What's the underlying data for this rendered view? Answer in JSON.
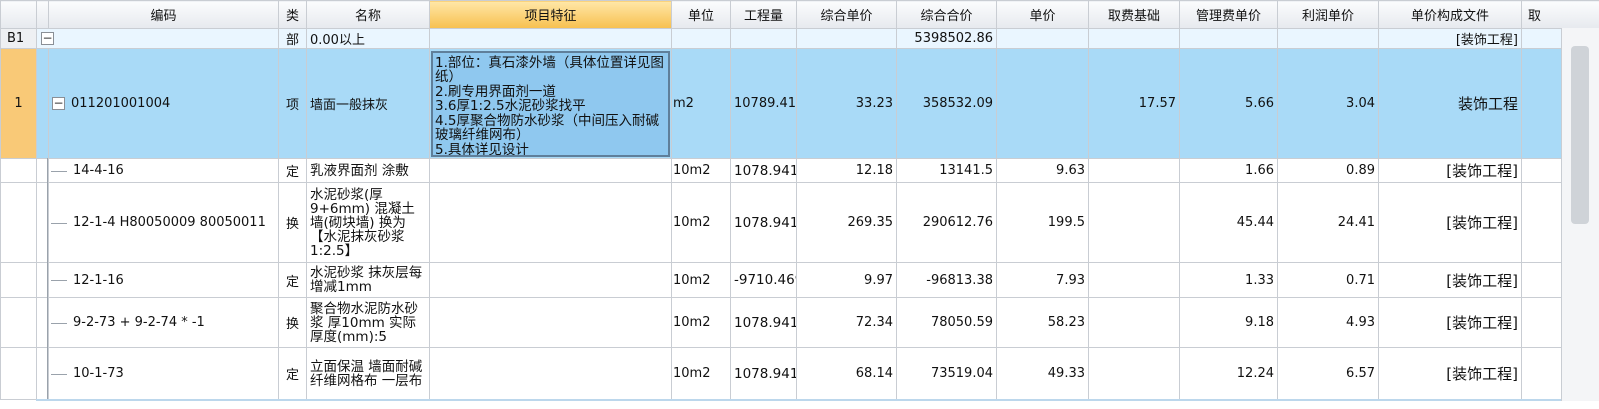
{
  "columns": [
    "编码",
    "类",
    "名称",
    "项目特征",
    "单位",
    "工程量",
    "综合单价",
    "综合合价",
    "单价",
    "取费基础",
    "管理费单价",
    "利润单价",
    "单价构成文件",
    "取"
  ],
  "section": {
    "id": "B1",
    "type": "部",
    "name": "0.00以上",
    "total": "5398502.86",
    "file": "[装饰工程]"
  },
  "item": {
    "index": "1",
    "code": "011201001004",
    "type": "项",
    "name": "墙面一般抹灰",
    "feature": "1.部位：真石漆外墙（具体位置详见图纸）\n2.刷专用界面剂一道\n3.6厚1:2.5水泥砂浆找平\n4.5厚聚合物防水砂浆（中间压入耐碱玻璃纤维网布）\n5.具体详见设计",
    "unit": "m2",
    "qty": "10789.41",
    "comp_price": "33.23",
    "comp_total": "358532.09",
    "price": "",
    "fee_base": "17.57",
    "mgmt": "5.66",
    "profit": "3.04",
    "file": "装饰工程"
  },
  "rows": [
    {
      "code": "14-4-16",
      "type": "定",
      "name": "乳液界面剂 涂敷",
      "unit": "10m2",
      "qty": "1078.941",
      "comp_price": "12.18",
      "comp_total": "13141.5",
      "price": "9.63",
      "fee_base": "",
      "mgmt": "1.66",
      "profit": "0.89",
      "file": "[装饰工程]"
    },
    {
      "code": "12-1-4 H80050009 80050011",
      "type": "换",
      "name": "水泥砂浆(厚9+6mm) 混凝土墙(砌块墙) 换为【水泥抹灰砂浆 1:2.5】",
      "unit": "10m2",
      "qty": "1078.941",
      "comp_price": "269.35",
      "comp_total": "290612.76",
      "price": "199.5",
      "fee_base": "",
      "mgmt": "45.44",
      "profit": "24.41",
      "file": "[装饰工程]"
    },
    {
      "code": "12-1-16",
      "type": "定",
      "name": "水泥砂浆 抹灰层每增减1mm",
      "unit": "10m2",
      "qty": "-9710.469",
      "comp_price": "9.97",
      "comp_total": "-96813.38",
      "price": "7.93",
      "fee_base": "",
      "mgmt": "1.33",
      "profit": "0.71",
      "file": "[装饰工程]"
    },
    {
      "code": "9-2-73 + 9-2-74 * -1",
      "type": "换",
      "name": "聚合物水泥防水砂浆 厚10mm 实际厚度(mm):5",
      "unit": "10m2",
      "qty": "1078.941",
      "comp_price": "72.34",
      "comp_total": "78050.59",
      "price": "58.23",
      "fee_base": "",
      "mgmt": "9.18",
      "profit": "4.93",
      "file": "[装饰工程]"
    },
    {
      "code": "10-1-73",
      "type": "定",
      "name": "立面保温 墙面耐碱纤维网格布 一层布",
      "unit": "10m2",
      "qty": "1078.941",
      "comp_price": "68.14",
      "comp_total": "73519.04",
      "price": "49.33",
      "fee_base": "",
      "mgmt": "12.24",
      "profit": "6.57",
      "file": "[装饰工程]"
    }
  ],
  "icons": {
    "collapse": "minus-box-icon",
    "scrollbar": "vertical-scrollbar"
  },
  "colors": {
    "header_highlight": "#f7c04f",
    "selected_row": "#a9daf7",
    "row_number_selected": "#f9c977"
  }
}
